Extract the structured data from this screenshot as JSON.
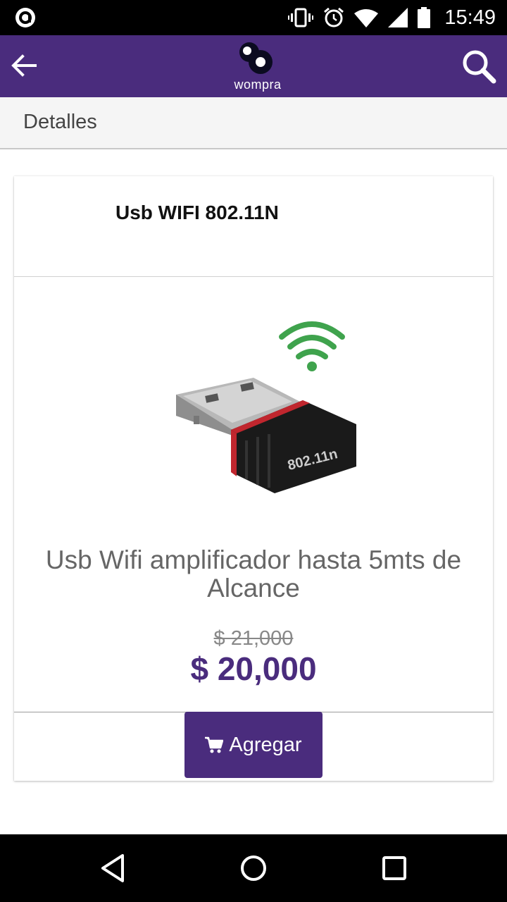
{
  "status_bar": {
    "time": "15:49",
    "icons": [
      "notification-icon",
      "vibrate-icon",
      "alarm-icon",
      "wifi-icon",
      "signal-icon",
      "battery-icon"
    ]
  },
  "app_bar": {
    "brand": "wompra",
    "color": "#4a2c7d",
    "icons": [
      "back-arrow-icon",
      "search-icon"
    ]
  },
  "subheader": {
    "title": "Detalles"
  },
  "product": {
    "title": "Usb WIFI 802.11N",
    "image_label": "802.11n",
    "description": "Usb Wifi amplificador hasta 5mts de Alcance",
    "old_price": "$ 21,000",
    "price": "$ 20,000",
    "add_button_label": "Agregar",
    "add_button_icon": "cart-icon"
  },
  "nav_bar": {
    "icons": [
      "back-triangle-icon",
      "home-circle-icon",
      "recents-square-icon"
    ]
  }
}
